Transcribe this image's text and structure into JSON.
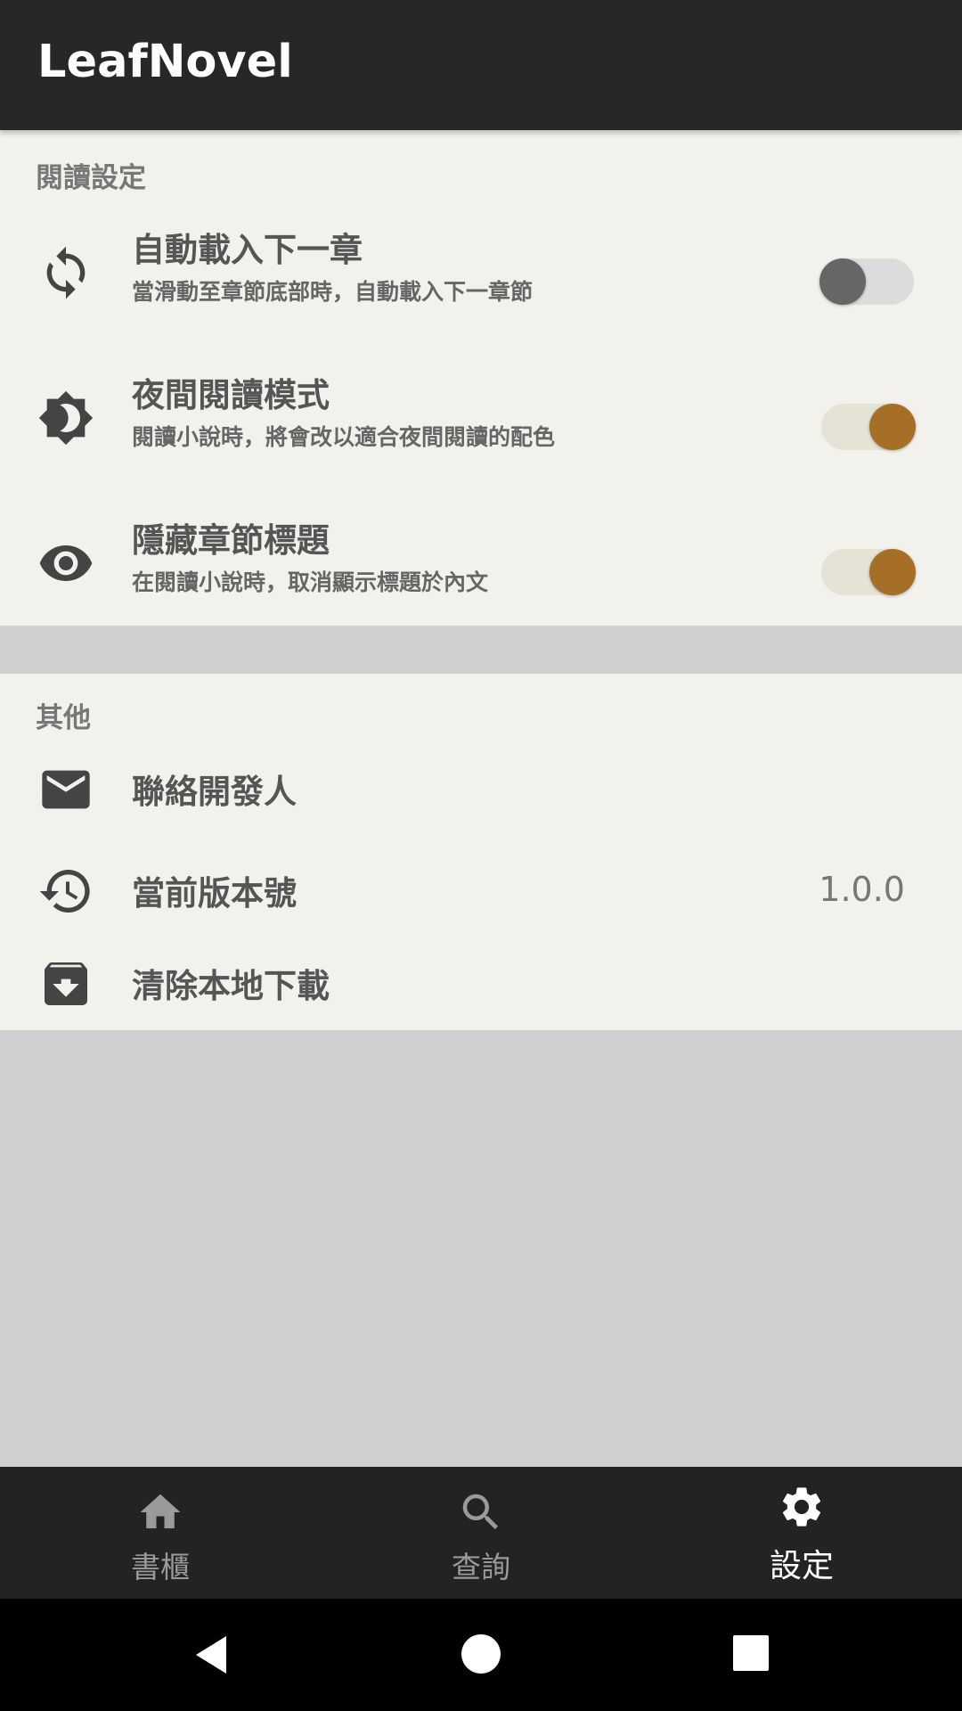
{
  "app": {
    "title": "LeafNovel"
  },
  "reading_section": {
    "header": "閱讀設定",
    "items": [
      {
        "icon": "sync-icon",
        "title": "自動載入下一章",
        "subtitle": "當滑動至章節底部時，自動載入下一章節",
        "toggle": "off"
      },
      {
        "icon": "brightness-icon",
        "title": "夜間閱讀模式",
        "subtitle": "閱讀小說時，將會改以適合夜間閱讀的配色",
        "toggle": "on"
      },
      {
        "icon": "eye-icon",
        "title": "隱藏章節標題",
        "subtitle": "在閱讀小說時，取消顯示標題於內文",
        "toggle": "on"
      }
    ]
  },
  "other_section": {
    "header": "其他",
    "items": [
      {
        "icon": "mail-icon",
        "title": "聯絡開發人"
      },
      {
        "icon": "history-icon",
        "title": "當前版本號",
        "value": "1.0.0"
      },
      {
        "icon": "archive-icon",
        "title": "清除本地下載"
      }
    ]
  },
  "bottom_nav": {
    "items": [
      {
        "icon": "home-icon",
        "label": "書櫃",
        "active": false
      },
      {
        "icon": "search-icon",
        "label": "查詢",
        "active": false
      },
      {
        "icon": "settings-icon",
        "label": "設定",
        "active": true
      }
    ]
  },
  "colors": {
    "accent": "#a66f27",
    "appbar": "#282627",
    "surface": "#f2f1ec"
  }
}
